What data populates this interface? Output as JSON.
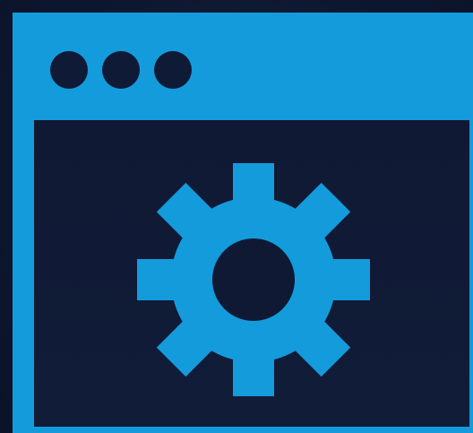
{
  "colors": {
    "background": "#0d1730",
    "window_frame": "#149bdc",
    "window_content": "#0f1934",
    "titlebar_dots": "#0f1a36",
    "gear": "#149bdc"
  },
  "titlebar": {
    "dot_count": 3
  },
  "icons": {
    "central": "gear-icon",
    "window_controls": [
      "window-control-dot",
      "window-control-dot",
      "window-control-dot"
    ]
  }
}
